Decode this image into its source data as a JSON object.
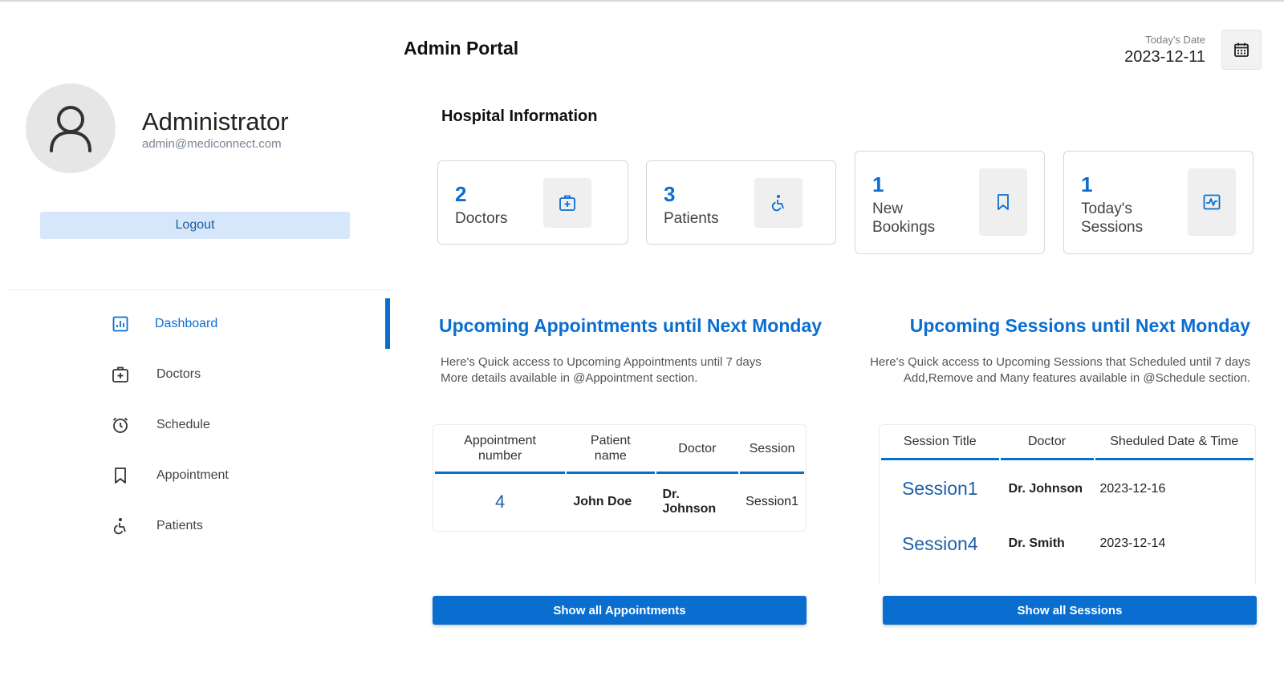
{
  "header": {
    "title": "Admin Portal",
    "date_label": "Today's Date",
    "date_value": "2023-12-11"
  },
  "profile": {
    "name": "Administrator",
    "email": "admin@mediconnect.com",
    "logout_label": "Logout"
  },
  "sidebar": {
    "items": [
      {
        "label": "Dashboard",
        "icon": "dashboard-icon",
        "active": true
      },
      {
        "label": "Doctors",
        "icon": "doctor-bag-icon"
      },
      {
        "label": "Schedule",
        "icon": "alarm-clock-icon"
      },
      {
        "label": "Appointment",
        "icon": "bookmark-icon"
      },
      {
        "label": "Patients",
        "icon": "wheelchair-icon"
      }
    ]
  },
  "hospital_info": {
    "title": "Hospital Information",
    "cards": [
      {
        "value": "2",
        "label": "Doctors",
        "icon": "doctor-bag-icon"
      },
      {
        "value": "3",
        "label": "Patients",
        "icon": "wheelchair-icon"
      },
      {
        "value": "1",
        "label_line1": "New",
        "label_line2": "Bookings",
        "icon": "bookmark-icon"
      },
      {
        "value": "1",
        "label_line1": "Today's",
        "label_line2": "Sessions",
        "icon": "activity-icon"
      }
    ]
  },
  "appointments": {
    "heading": "Upcoming Appointments until Next Monday",
    "desc_line1": "Here's Quick access to Upcoming Appointments until 7 days",
    "desc_line2": "More details available in @Appointment section.",
    "columns": {
      "number_line1": "Appointment",
      "number_line2": "number",
      "patient_line1": "Patient",
      "patient_line2": "name",
      "doctor": "Doctor",
      "session": "Session"
    },
    "rows": [
      {
        "number": "4",
        "patient": "John Doe",
        "doctor_line1": "Dr.",
        "doctor_line2": "Johnson",
        "session": "Session1"
      }
    ],
    "button_label": "Show all Appointments"
  },
  "sessions": {
    "heading": "Upcoming Sessions until Next Monday",
    "desc_line1": "Here's Quick access to Upcoming Sessions that Scheduled until 7 days",
    "desc_line2": "Add,Remove and Many features available in @Schedule section.",
    "columns": {
      "title": "Session Title",
      "doctor": "Doctor",
      "datetime": "Sheduled Date & Time"
    },
    "rows": [
      {
        "title": "Session1",
        "doctor": "Dr. Johnson",
        "date": "2023-12-16"
      },
      {
        "title": "Session4",
        "doctor": "Dr. Smith",
        "date": "2023-12-14"
      }
    ],
    "button_label": "Show all Sessions"
  },
  "colors": {
    "accent": "#0a6ed1",
    "logout_bg": "#d6e7fb",
    "icon_box_bg": "#efefef"
  }
}
